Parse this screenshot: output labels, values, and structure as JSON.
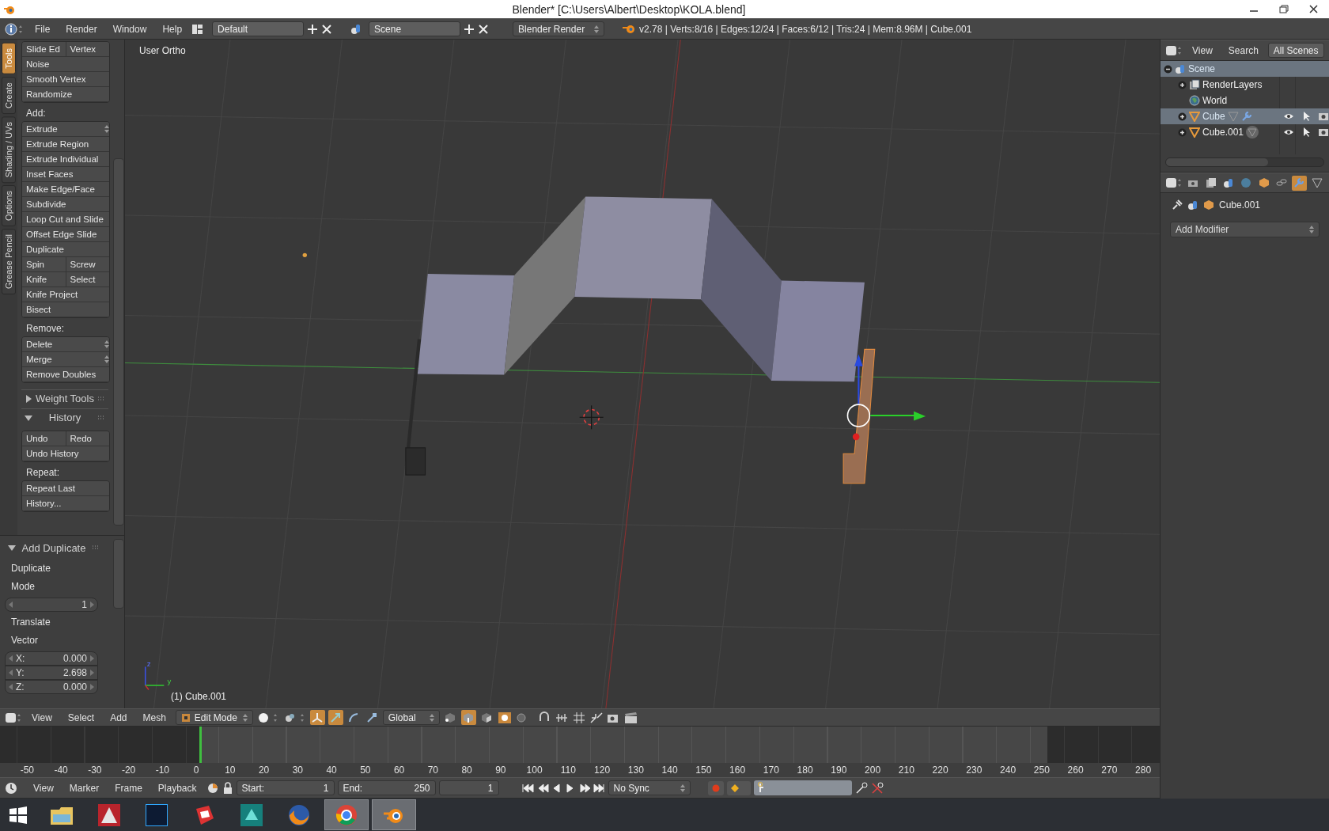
{
  "window": {
    "title": "Blender* [C:\\Users\\Albert\\Desktop\\KOLA.blend]"
  },
  "info_header": {
    "menus": [
      "File",
      "Render",
      "Window",
      "Help"
    ],
    "layout": "Default",
    "scene": "Scene",
    "engine": "Blender Render",
    "stats": "v2.78 | Verts:8/16 | Edges:12/24 | Faces:6/12 | Tris:24 | Mem:8.96M | Cube.001"
  },
  "toolshelf": {
    "tabs": [
      {
        "label": "Tools",
        "selected": true
      },
      {
        "label": "Create",
        "selected": false
      },
      {
        "label": "Shading / UVs",
        "selected": false
      },
      {
        "label": "Options",
        "selected": false
      },
      {
        "label": "Grease Pencil",
        "selected": false
      }
    ],
    "groups": [
      {
        "rows": [
          [
            {
              "label": "Slide Ed",
              "kind": "button"
            },
            {
              "label": "Vertex",
              "kind": "button"
            }
          ],
          [
            {
              "label": "Noise",
              "kind": "button"
            }
          ],
          [
            {
              "label": "Smooth Vertex",
              "kind": "button"
            }
          ],
          [
            {
              "label": "Randomize",
              "kind": "button"
            }
          ]
        ]
      },
      {
        "heading": "Add:",
        "rows": [
          [
            {
              "label": "Extrude",
              "kind": "dropdown"
            }
          ],
          [
            {
              "label": "Extrude Region",
              "kind": "button"
            }
          ],
          [
            {
              "label": "Extrude Individual",
              "kind": "button"
            }
          ],
          [
            {
              "label": "Inset Faces",
              "kind": "button"
            }
          ],
          [
            {
              "label": "Make Edge/Face",
              "kind": "button"
            }
          ],
          [
            {
              "label": "Subdivide",
              "kind": "button"
            }
          ],
          [
            {
              "label": "Loop Cut and Slide",
              "kind": "button"
            }
          ],
          [
            {
              "label": "Offset Edge Slide",
              "kind": "button"
            }
          ],
          [
            {
              "label": "Duplicate",
              "kind": "button"
            }
          ],
          [
            {
              "label": "Spin",
              "kind": "button"
            },
            {
              "label": "Screw",
              "kind": "button"
            }
          ],
          [
            {
              "label": "Knife",
              "kind": "button"
            },
            {
              "label": "Select",
              "kind": "button"
            }
          ],
          [
            {
              "label": "Knife Project",
              "kind": "button"
            }
          ],
          [
            {
              "label": "Bisect",
              "kind": "button"
            }
          ]
        ]
      },
      {
        "heading": "Remove:",
        "rows": [
          [
            {
              "label": "Delete",
              "kind": "dropdown"
            }
          ],
          [
            {
              "label": "Merge",
              "kind": "dropdown"
            }
          ],
          [
            {
              "label": "Remove Doubles",
              "kind": "button"
            }
          ]
        ]
      }
    ],
    "panels": [
      {
        "title": "Weight Tools",
        "expanded": false
      },
      {
        "title": "History",
        "expanded": true,
        "groups": [
          {
            "rows": [
              [
                {
                  "label": "Undo",
                  "kind": "button"
                },
                {
                  "label": "Redo",
                  "kind": "button"
                }
              ],
              [
                {
                  "label": "Undo History",
                  "kind": "button"
                }
              ]
            ]
          },
          {
            "heading": "Repeat:",
            "rows": [
              [
                {
                  "label": "Repeat Last",
                  "kind": "button"
                }
              ],
              [
                {
                  "label": "History...",
                  "kind": "button"
                }
              ]
            ]
          }
        ]
      }
    ]
  },
  "operator_panel": {
    "title": "Add Duplicate",
    "expanded": true,
    "items": [
      {
        "kind": "label",
        "text": "Duplicate"
      },
      {
        "kind": "label",
        "text": "Mode"
      },
      {
        "kind": "number",
        "value": "1"
      },
      {
        "kind": "label",
        "text": "Translate"
      },
      {
        "kind": "label",
        "text": "Vector"
      },
      {
        "kind": "axis",
        "label": "X:",
        "value": "0.000"
      },
      {
        "kind": "axis",
        "label": "Y:",
        "value": "2.698"
      },
      {
        "kind": "axis",
        "label": "Z:",
        "value": "0.000"
      }
    ]
  },
  "viewport": {
    "view_name": "User Ortho",
    "object_label": "(1) Cube.001",
    "axis_labels": [
      "z",
      "y"
    ]
  },
  "view3d_header": {
    "menus": [
      "View",
      "Select",
      "Add",
      "Mesh"
    ],
    "mode": "Edit Mode",
    "orientation": "Global",
    "manipulators": [
      {
        "kind": "manipulator",
        "selected": true
      },
      {
        "kind": "translate",
        "selected": true
      },
      {
        "kind": "rotate",
        "selected": false
      },
      {
        "kind": "scale",
        "selected": false
      }
    ],
    "select_modes": [
      {
        "kind": "vertex",
        "selected": false
      },
      {
        "kind": "edge",
        "selected": true
      },
      {
        "kind": "face",
        "selected": false
      }
    ]
  },
  "timeline": {
    "ticks": [
      "-50",
      "-40",
      "-30",
      "-20",
      "-10",
      "0",
      "10",
      "20",
      "30",
      "40",
      "50",
      "60",
      "70",
      "80",
      "90",
      "100",
      "110",
      "120",
      "130",
      "140",
      "150",
      "160",
      "170",
      "180",
      "190",
      "200",
      "210",
      "220",
      "230",
      "240",
      "250",
      "260",
      "270",
      "280"
    ],
    "menus": [
      "View",
      "Marker",
      "Frame",
      "Playback"
    ],
    "start_label": "Start:",
    "start": "1",
    "end_label": "End:",
    "end": "250",
    "current": "1",
    "sync": "No Sync"
  },
  "outliner": {
    "menus": [
      "View",
      "Search"
    ],
    "filter": "All Scenes",
    "tree": [
      {
        "label": "Scene",
        "kind": "scene",
        "selected": true,
        "expanded": true,
        "children": [
          {
            "label": "RenderLayers",
            "kind": "render-layers",
            "selected": false,
            "expanded": false
          },
          {
            "label": "World",
            "kind": "world",
            "selected": false
          },
          {
            "label": "Cube",
            "kind": "mesh-object",
            "selected": true,
            "expanded": false,
            "modifier": true,
            "data_highlighted": false
          },
          {
            "label": "Cube.001",
            "kind": "mesh-object",
            "selected": false,
            "expanded": false,
            "modifier": false,
            "data_highlighted": true
          }
        ]
      }
    ]
  },
  "properties": {
    "tabs": [
      {
        "kind": "render",
        "selected": false
      },
      {
        "kind": "render-layers",
        "selected": false
      },
      {
        "kind": "scene",
        "selected": false
      },
      {
        "kind": "world",
        "selected": false
      },
      {
        "kind": "object",
        "selected": false
      },
      {
        "kind": "constraints",
        "selected": false
      },
      {
        "kind": "modifiers",
        "selected": true
      },
      {
        "kind": "data",
        "selected": false
      }
    ],
    "object": "Cube.001",
    "add_modifier": "Add Modifier"
  },
  "taskbar": {
    "apps": [
      {
        "kind": "folder",
        "selected": false
      },
      {
        "kind": "cad",
        "selected": false
      },
      {
        "kind": "image-editor",
        "selected": false
      },
      {
        "kind": "sketch",
        "selected": false
      },
      {
        "kind": "modeler",
        "selected": false
      },
      {
        "kind": "browser-fox",
        "selected": false
      },
      {
        "kind": "browser-ring",
        "selected": true
      },
      {
        "kind": "blender",
        "selected": true
      }
    ]
  }
}
